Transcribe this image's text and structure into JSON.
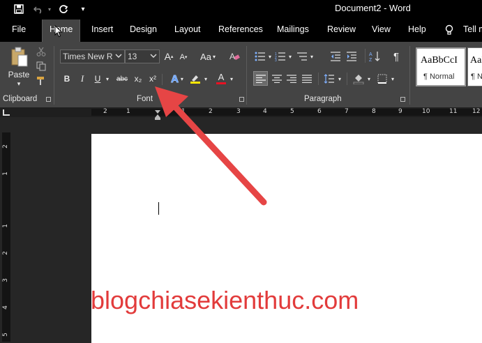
{
  "window": {
    "title": "Document2 - Word"
  },
  "tabs": [
    "File",
    "Home",
    "Insert",
    "Design",
    "Layout",
    "References",
    "Mailings",
    "Review",
    "View",
    "Help",
    "Tell m"
  ],
  "clipboard": {
    "paste_label": "Paste",
    "group_label": "Clipboard"
  },
  "font": {
    "name": "Times New R",
    "size": "13",
    "case_label": "Aa",
    "bold": "B",
    "italic": "I",
    "underline": "U",
    "strike": "abc",
    "subscript": "x₂",
    "superscript": "x²",
    "effects": "A",
    "color_letter": "A",
    "group_label": "Font"
  },
  "paragraph": {
    "group_label": "Paragraph",
    "pilcrow": "¶"
  },
  "styles": {
    "normal_preview": "AaBbCcI",
    "normal_label": "¶ Normal",
    "next_preview": "AaBb",
    "next_label": "¶ N"
  },
  "ruler": {
    "h_ticks": [
      "2",
      "1",
      "1",
      "2",
      "3",
      "4",
      "5",
      "6",
      "7",
      "8",
      "9",
      "10",
      "11",
      "12"
    ],
    "v_ticks": [
      "2",
      "1",
      "1",
      "2",
      "3",
      "4",
      "5"
    ]
  },
  "document": {
    "watermark": "blogchiasekienthuc.com"
  },
  "colors": {
    "accent_arrow": "#e64545",
    "highlight": "#ffe600",
    "font_color": "#e81123"
  }
}
